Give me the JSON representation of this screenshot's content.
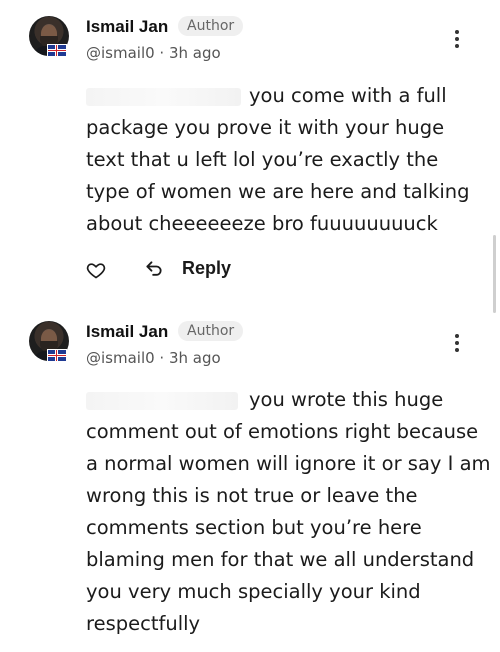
{
  "comments": [
    {
      "author": "Ismail Jan",
      "badge": "Author",
      "handle": "@ismail0 · 3h ago",
      "lines": [
        "you come with a full",
        "package you prove it with your huge",
        "text that  u left lol you’re exactly the",
        "type of women we are here and talking",
        "about cheeeeeeze bro fuuuuuuuuck"
      ],
      "reply_label": "Reply"
    },
    {
      "author": "Ismail Jan",
      "badge": "Author",
      "handle": "@ismail0 · 3h ago",
      "lines": [
        "you wrote this huge",
        "comment out of emotions right because",
        "a normal women will ignore it or say I am",
        "wrong this is not true or leave the",
        "comments section but you’re here",
        "blaming men for that we all understand",
        "you very much specially your kind",
        "respectfully"
      ]
    }
  ],
  "icons": {
    "like": "heart-outline-icon",
    "reply": "reply-arrow-icon",
    "menu": "more-vertical-icon",
    "flag": "uk-flag-icon"
  }
}
